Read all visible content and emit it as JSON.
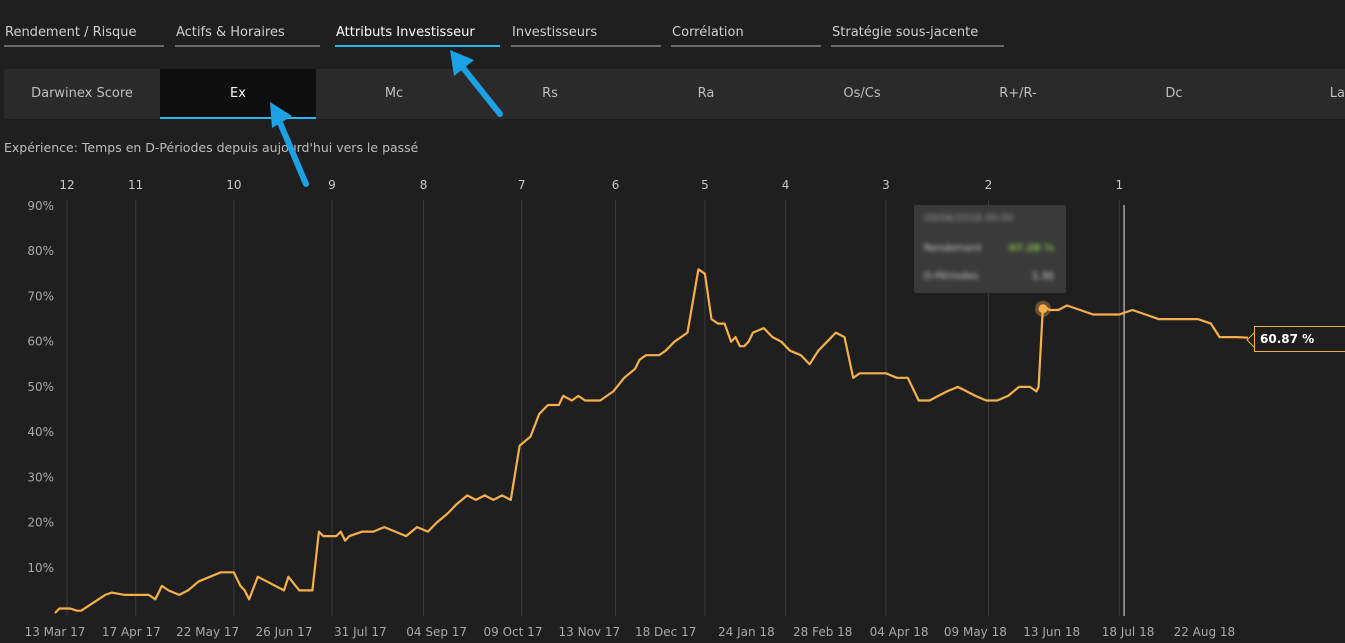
{
  "top_tabs": [
    {
      "label": "Rendement / Risque",
      "active": false
    },
    {
      "label": "Actifs & Horaires",
      "active": false
    },
    {
      "label": "Attributs Investisseur",
      "active": true
    },
    {
      "label": "Investisseurs",
      "active": false
    },
    {
      "label": "Corrélation",
      "active": false
    },
    {
      "label": "Stratégie sous-jacente",
      "active": false
    }
  ],
  "sub_tabs": [
    {
      "label": "Darwinex Score",
      "active": false
    },
    {
      "label": "Ex",
      "active": true
    },
    {
      "label": "Mc",
      "active": false
    },
    {
      "label": "Rs",
      "active": false
    },
    {
      "label": "Ra",
      "active": false
    },
    {
      "label": "Os/Cs",
      "active": false
    },
    {
      "label": "R+/R-",
      "active": false
    },
    {
      "label": "Dc",
      "active": false
    },
    {
      "label": "La",
      "active": false
    }
  ],
  "caption": "Expérience: Temps en D-Périodes depuis aujourd'hui vers le passé",
  "tooltip": {
    "date": "09/06/2018 00:00",
    "row1_label": "Rendement",
    "row1_value": "67.28 %",
    "row2_label": "D-Périodes",
    "row2_value": "1.31"
  },
  "colors": {
    "line": "#f5b049",
    "accent": "#29b6f6",
    "background": "#1f1f1f",
    "tooltip_value_green": "#8bc34a"
  },
  "chart_data": {
    "type": "line",
    "title": "",
    "xlabel": "",
    "ylabel": "",
    "ylim": [
      0,
      90
    ],
    "y_ticks": [
      "10%",
      "20%",
      "30%",
      "40%",
      "50%",
      "60%",
      "70%",
      "80%",
      "90%"
    ],
    "x_ticks": [
      "13 Mar 17",
      "17 Apr 17",
      "22 May 17",
      "26 Jun 17",
      "31 Jul 17",
      "04 Sep 17",
      "09 Oct 17",
      "13 Nov 17",
      "18 Dec 17",
      "24 Jan 18",
      "28 Feb 18",
      "04 Apr 18",
      "09 May 18",
      "13 Jun 18",
      "18 Jul 18",
      "22 Aug 18"
    ],
    "d_period_ticks": [
      "12",
      "11",
      "10",
      "9",
      "8",
      "7",
      "6",
      "5",
      "4",
      "3",
      "2",
      "1"
    ],
    "last_value_label": "60.87 %",
    "highlight_point": {
      "date": "09 Jun 18",
      "value": 67.28
    },
    "cursor_date": "18 Jul 18",
    "series": [
      {
        "x": [
          "13 Mar 17",
          "15 Mar 17",
          "20 Mar 17",
          "23 Mar 17",
          "25 Mar 17",
          "05 Apr 17",
          "08 Apr 17",
          "14 Apr 17",
          "25 Apr 17",
          "28 Apr 17",
          "01 May 17",
          "04 May 17",
          "09 May 17",
          "13 May 17",
          "18 May 17",
          "23 May 17",
          "28 May 17",
          "03 Jun 17",
          "06 Jun 17",
          "08 Jun 17",
          "10 Jun 17",
          "14 Jun 17",
          "18 Jun 17",
          "22 Jun 17",
          "26 Jun 17",
          "28 Jun 17",
          "03 Jul 17",
          "06 Jul 17",
          "09 Jul 17",
          "12 Jul 17",
          "14 Jul 17",
          "17 Jul 17",
          "20 Jul 17",
          "22 Jul 17",
          "24 Jul 17",
          "26 Jul 17",
          "01 Aug 17",
          "06 Aug 17",
          "11 Aug 17",
          "16 Aug 17",
          "21 Aug 17",
          "26 Aug 17",
          "31 Aug 17",
          "04 Sep 17",
          "09 Sep 17",
          "13 Sep 17",
          "18 Sep 17",
          "22 Sep 17",
          "26 Sep 17",
          "30 Sep 17",
          "04 Oct 17",
          "08 Oct 17",
          "12 Oct 17",
          "17 Oct 17",
          "21 Oct 17",
          "25 Oct 17",
          "30 Oct 17",
          "01 Nov 17",
          "05 Nov 17",
          "08 Nov 17",
          "11 Nov 17",
          "14 Nov 17",
          "18 Nov 17",
          "24 Nov 17",
          "29 Nov 17",
          "04 Dec 17",
          "06 Dec 17",
          "09 Dec 17",
          "12 Dec 17",
          "15 Dec 17",
          "18 Dec 17",
          "22 Dec 17",
          "28 Dec 17",
          "02 Jan 18",
          "05 Jan 18",
          "08 Jan 18",
          "11 Jan 18",
          "14 Jan 18",
          "17 Jan 18",
          "19 Jan 18",
          "21 Jan 18",
          "23 Jan 18",
          "25 Jan 18",
          "27 Jan 18",
          "01 Feb 18",
          "05 Feb 18",
          "09 Feb 18",
          "13 Feb 18",
          "18 Feb 18",
          "22 Feb 18",
          "26 Feb 18",
          "02 Mar 18",
          "06 Mar 18",
          "10 Mar 18",
          "14 Mar 18",
          "17 Mar 18",
          "20 Mar 18",
          "24 Mar 18",
          "29 Mar 18",
          "03 Apr 18",
          "08 Apr 18",
          "13 Apr 18",
          "18 Apr 18",
          "22 Apr 18",
          "26 Apr 18",
          "01 May 18",
          "05 May 18",
          "09 May 18",
          "14 May 18",
          "19 May 18",
          "24 May 18",
          "29 May 18",
          "03 Jun 18",
          "06 Jun 18",
          "07 Jun 18",
          "09 Jun 18",
          "12 Jun 18",
          "16 Jun 18",
          "20 Jun 18",
          "26 Jun 18",
          "02 Jul 18",
          "08 Jul 18",
          "14 Jul 18",
          "20 Jul 18",
          "26 Jul 18",
          "01 Aug 18",
          "07 Aug 18",
          "13 Aug 18",
          "19 Aug 18",
          "25 Aug 18",
          "29 Aug 18",
          "02 Sep 18",
          "06 Sep 18",
          "11 Sep 18"
        ],
        "y": [
          0,
          1,
          1,
          0.5,
          0.5,
          4,
          4.5,
          4,
          4,
          3,
          6,
          5,
          4,
          5,
          7,
          8,
          9,
          9,
          6,
          5,
          3,
          8,
          7,
          6,
          5,
          8,
          5,
          5,
          5,
          18,
          17,
          17,
          17,
          18,
          16,
          17,
          18,
          18,
          19,
          18,
          17,
          19,
          18,
          20,
          22,
          24,
          26,
          25,
          26,
          25,
          26,
          25,
          37,
          39,
          44,
          46,
          46,
          48,
          47,
          48,
          47,
          47,
          47,
          49,
          52,
          54,
          56,
          57,
          57,
          57,
          58,
          60,
          62,
          76,
          75,
          65,
          64,
          64,
          60,
          61,
          59,
          59,
          60,
          62,
          63,
          61,
          60,
          58,
          57,
          55,
          58,
          60,
          62,
          61,
          52,
          53,
          53,
          53,
          53,
          52,
          52,
          47,
          47,
          48,
          49,
          50,
          49,
          48,
          47,
          47,
          48,
          50,
          50,
          49,
          50,
          68,
          67,
          67,
          68,
          67,
          66,
          66,
          66,
          67,
          66,
          65,
          65,
          65,
          65,
          64,
          61,
          61,
          61,
          60.87
        ]
      }
    ]
  }
}
